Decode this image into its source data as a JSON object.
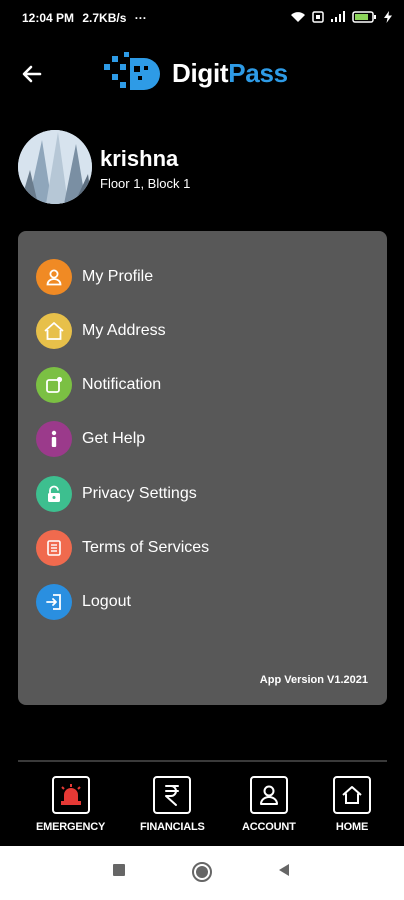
{
  "status": {
    "time": "12:04 PM",
    "speed": "2.7KB/s",
    "more": "···"
  },
  "header": {
    "logo_part1": "Digit",
    "logo_part2": "Pass",
    "colors": {
      "accent": "#2e9be6"
    }
  },
  "profile": {
    "name": "krishna",
    "location": "Floor 1, Block 1"
  },
  "menu": {
    "items": [
      {
        "label": "My Profile",
        "icon": "user-icon",
        "color": "#f08a24"
      },
      {
        "label": "My Address",
        "icon": "home-icon",
        "color": "#e7c04a"
      },
      {
        "label": "Notification",
        "icon": "notification-icon",
        "color": "#7bc043"
      },
      {
        "label": "Get Help",
        "icon": "info-icon",
        "color": "#9b3a8b"
      },
      {
        "label": "Privacy Settings",
        "icon": "lock-icon",
        "color": "#3dbf8f"
      },
      {
        "label": "Terms of Services",
        "icon": "document-icon",
        "color": "#f06a4e"
      },
      {
        "label": "Logout",
        "icon": "logout-icon",
        "color": "#2a8fe0"
      }
    ],
    "app_version": "App Version V1.2021"
  },
  "bottom_nav": {
    "items": [
      {
        "label": "EMERGENCY",
        "icon": "alarm-icon"
      },
      {
        "label": "FINANCIALS",
        "icon": "rupee-icon"
      },
      {
        "label": "ACCOUNT",
        "icon": "user-icon"
      },
      {
        "label": "HOME",
        "icon": "home-icon"
      }
    ]
  }
}
